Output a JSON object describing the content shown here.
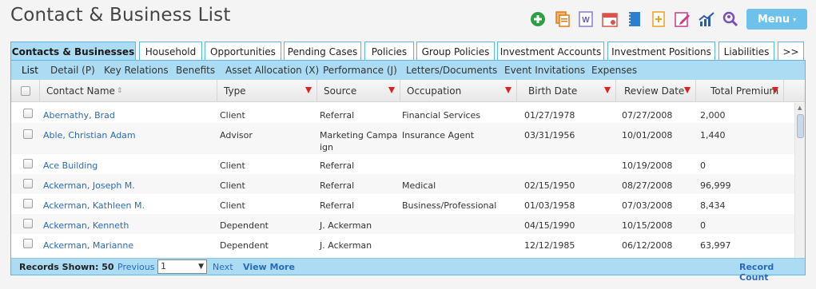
{
  "title": "Contact & Business List",
  "menu": {
    "label": "Menu",
    "caret": "▾"
  },
  "toolbar_icons": [
    {
      "name": "add-contact-icon",
      "color": "#2ea043"
    },
    {
      "name": "copy-documents-icon",
      "color": "#e07b1a"
    },
    {
      "name": "word-document-icon",
      "color": "#6b5bb8"
    },
    {
      "name": "calendar-icon",
      "color": "#d9534f"
    },
    {
      "name": "notebook-icon",
      "color": "#2a7fd0"
    },
    {
      "name": "new-document-icon",
      "color": "#e8a21f"
    },
    {
      "name": "edit-form-icon",
      "color": "#cc3a8a"
    },
    {
      "name": "trend-chart-icon",
      "color": "#2a5ca8"
    },
    {
      "name": "search-people-icon",
      "color": "#7a4fb8"
    }
  ],
  "tabs": [
    "Contacts & Businesses",
    "Household",
    "Opportunities",
    "Pending Cases",
    "Policies",
    "Group Policies",
    "Investment Accounts",
    "Investment Positions",
    "Liabilities",
    ">>"
  ],
  "subnav": [
    "List",
    "Detail (P)",
    "Key Relations",
    "Benefits",
    "Asset Allocation (X)",
    "Performance (J)",
    "Letters/Documents",
    "Event Invitations",
    "Expenses"
  ],
  "columns": {
    "name": "Contact Name",
    "type": "Type",
    "source": "Source",
    "occupation": "Occupation",
    "birth": "Birth Date",
    "review": "Review Date",
    "premium": "Total Premium"
  },
  "rows": [
    {
      "name": "Abernathy, Brad",
      "type": "Client",
      "source": "Referral",
      "occupation": "Financial Services",
      "birth": "01/27/1978",
      "review": "07/27/2008",
      "premium": "2,000"
    },
    {
      "name": "Able, Christian Adam",
      "type": "Advisor",
      "source": "Marketing Campaign",
      "occupation": "Insurance Agent",
      "birth": "03/31/1956",
      "review": "10/01/2008",
      "premium": "1,440"
    },
    {
      "name": "Ace Building",
      "type": "Client",
      "source": "Referral",
      "occupation": "",
      "birth": "",
      "review": "10/19/2008",
      "premium": "0"
    },
    {
      "name": "Ackerman, Joseph M.",
      "type": "Client",
      "source": "Referral",
      "occupation": "Medical",
      "birth": "02/15/1950",
      "review": "08/27/2008",
      "premium": "96,999"
    },
    {
      "name": "Ackerman, Kathleen M.",
      "type": "Client",
      "source": "Referral",
      "occupation": "Business/Professional",
      "birth": "01/03/1958",
      "review": "07/03/2008",
      "premium": "8,434"
    },
    {
      "name": "Ackerman, Kenneth",
      "type": "Dependent",
      "source": "J. Ackerman",
      "occupation": "",
      "birth": "04/15/1990",
      "review": "10/15/2008",
      "premium": "0"
    },
    {
      "name": "Ackerman, Marianne",
      "type": "Dependent",
      "source": "J. Ackerman",
      "occupation": "",
      "birth": "12/12/1985",
      "review": "06/12/2008",
      "premium": "63,997"
    }
  ],
  "footer": {
    "records_shown": "Records Shown: 50",
    "previous": "Previous",
    "page": "1",
    "next": "Next",
    "view_more": "View More",
    "record_count": "Record Count"
  }
}
